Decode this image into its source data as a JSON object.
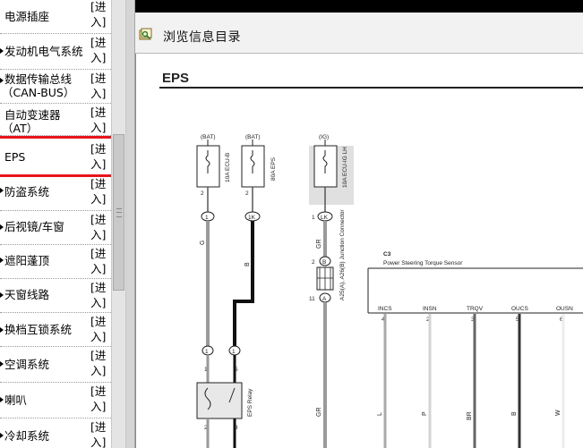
{
  "sidebar": {
    "items": [
      {
        "label": "电源插座",
        "enter": "[进入]"
      },
      {
        "label": "发动机电气系统",
        "enter": "[进入]"
      },
      {
        "label": "数据传输总线",
        "label2": "（CAN-BUS）",
        "enter": "[进入]"
      },
      {
        "label": "自动变速器",
        "label2": "（AT）",
        "enter": "[进入]"
      },
      {
        "label": "EPS",
        "enter": "[进入]"
      },
      {
        "label": "防盗系统",
        "enter": "[进入]"
      },
      {
        "label": "后视镜/车窗",
        "enter": "[进入]"
      },
      {
        "label": "遮阳蓬顶",
        "enter": "[进入]"
      },
      {
        "label": "天窗线路",
        "enter": "[进入]"
      },
      {
        "label": "换档互锁系统",
        "enter": "[进入]"
      },
      {
        "label": "空调系统",
        "enter": "[进入]"
      },
      {
        "label": "喇叭",
        "enter": "[进入]"
      },
      {
        "label": "冷却系统",
        "enter": "[进入]"
      }
    ]
  },
  "toolbar": {
    "title": "浏览信息目录"
  },
  "document": {
    "title": "EPS",
    "fuse1": {
      "source": "(BAT)",
      "pin": "2",
      "rating": "10A ECU-B",
      "conn": "1",
      "wire": "G"
    },
    "fuse2": {
      "source": "(BAT)",
      "pin": "2",
      "rating": "80A EPS",
      "conn": "1K",
      "wire": "B"
    },
    "fuse3": {
      "source": "(IG)",
      "pin": "1",
      "rating": "10A ECU-IG LH",
      "conn_pin": "1",
      "conn": "LK",
      "wire": "GR"
    },
    "junction": {
      "pin_top": "2",
      "conn_top": "B",
      "pin_bot": "11",
      "conn_bot": "A",
      "name": "A25(A), A26(B) Junction Connector",
      "wire": "GR"
    },
    "relay": {
      "pin_left": "1",
      "pin_right": "5",
      "conn_left": "1",
      "conn_right": "1",
      "pin_bl": "2",
      "pin_br": "3",
      "name": "EPS Relay"
    },
    "sensor": {
      "id": "C3",
      "name": "Power Steering Torque Sensor",
      "pins": [
        {
          "name": "INCS",
          "num": "4",
          "wire": "L"
        },
        {
          "name": "INSN",
          "num": "2",
          "wire": "P"
        },
        {
          "name": "TRQV",
          "num": "3",
          "wire": "BR"
        },
        {
          "name": "OUCS",
          "num": "5",
          "wire": "B"
        },
        {
          "name": "OUSN",
          "num": "6",
          "wire": "W"
        }
      ]
    }
  },
  "colors": {
    "selection_border": "#e8141a"
  }
}
